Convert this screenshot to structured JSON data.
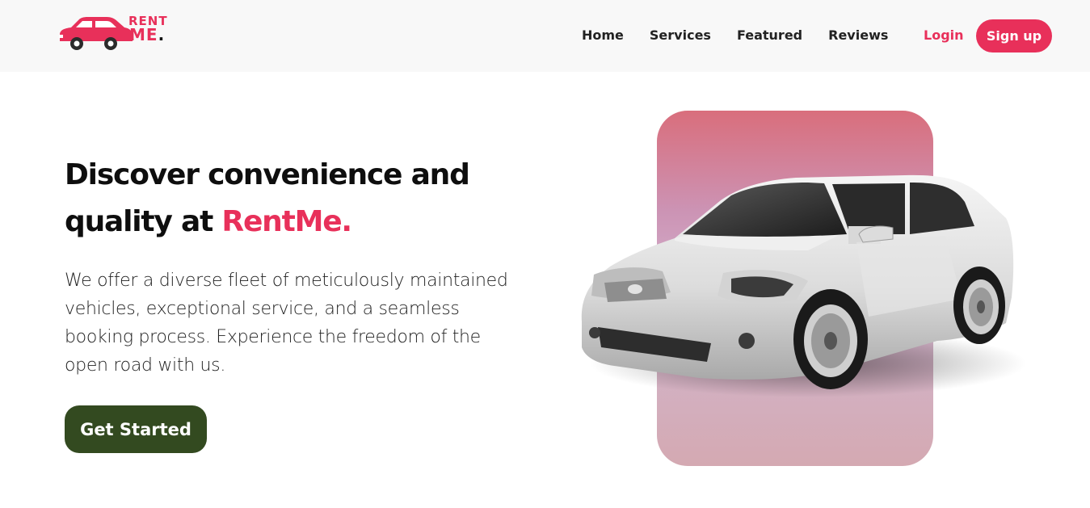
{
  "brand": {
    "logo_top": "RENT",
    "logo_bottom": "ME",
    "logo_dot": ".",
    "accent_color": "#e8305a"
  },
  "nav": {
    "links": [
      "Home",
      "Services",
      "Featured",
      "Reviews"
    ],
    "login_label": "Login",
    "signup_label": "Sign up"
  },
  "hero": {
    "title_part1": "Discover convenience and quality at ",
    "title_brand": "RentMe.",
    "description": "We offer a diverse fleet of meticulously maintained vehicles, exceptional service, and a seamless booking process. Experience the freedom of the open road with us.",
    "cta_label": "Get Started",
    "cta_color": "#334a20"
  },
  "icons": {
    "logo": "car-icon",
    "hero_image": "silver-sedan-car"
  }
}
